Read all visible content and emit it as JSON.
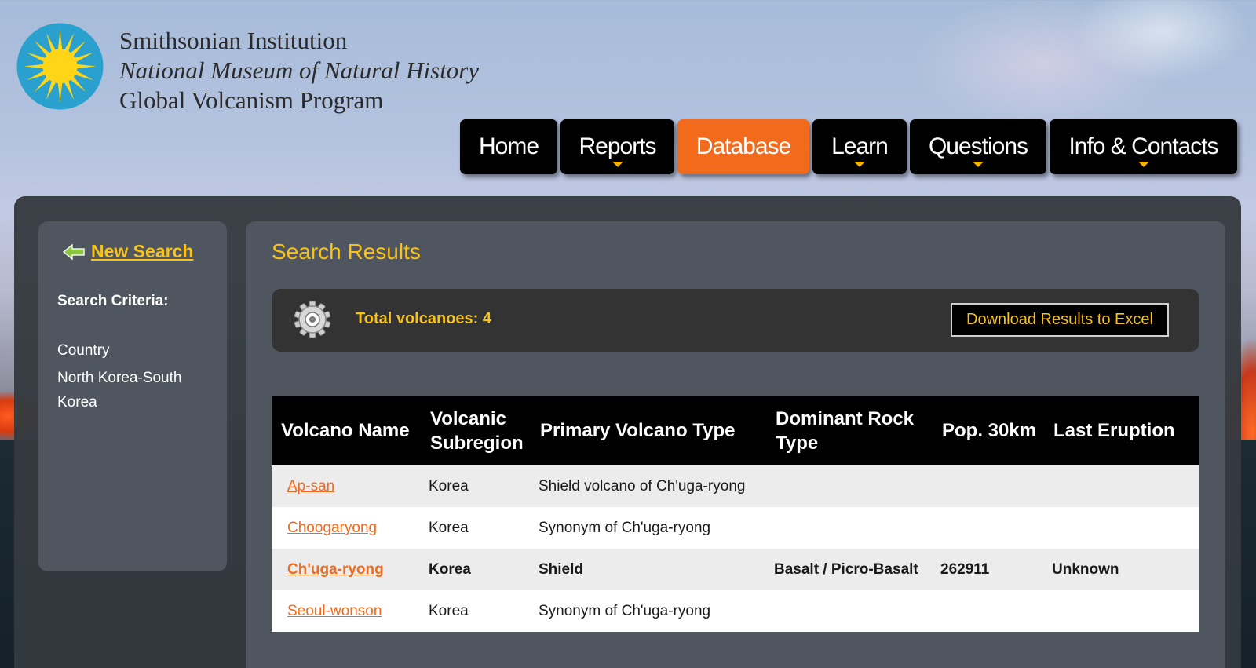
{
  "header": {
    "org": "Smithsonian Institution",
    "museum": "National Museum of Natural History",
    "program": "Global Volcanism Program"
  },
  "nav": [
    {
      "label": "Home",
      "has_menu": false,
      "active": false
    },
    {
      "label": "Reports",
      "has_menu": true,
      "active": false
    },
    {
      "label": "Database",
      "has_menu": false,
      "active": true
    },
    {
      "label": "Learn",
      "has_menu": true,
      "active": false
    },
    {
      "label": "Questions",
      "has_menu": true,
      "active": false
    },
    {
      "label": "Info & Contacts",
      "has_menu": true,
      "active": false
    }
  ],
  "sidebar": {
    "new_search_label": "New Search",
    "criteria_title": "Search Criteria:",
    "criteria_key": "Country",
    "criteria_value": "North Korea-South Korea"
  },
  "results": {
    "title": "Search Results",
    "total_label": "Total volcanoes: 4",
    "download_label": "Download Results to Excel",
    "columns": [
      "Volcano Name",
      "Volcanic Subregion",
      "Primary Volcano Type",
      "Dominant Rock Type",
      "Pop. 30km",
      "Last Eruption"
    ],
    "rows": [
      {
        "name": "Ap-san",
        "subregion": "Korea",
        "type": "Shield volcano of Ch'uga-ryong",
        "rock": "",
        "pop": "",
        "last": ""
      },
      {
        "name": "Choogaryong",
        "subregion": "Korea",
        "type": "Synonym of Ch'uga-ryong",
        "rock": "",
        "pop": "",
        "last": ""
      },
      {
        "name": "Ch'uga-ryong",
        "subregion": "Korea",
        "type": "Shield",
        "rock": "Basalt / Picro-Basalt",
        "pop": "262911",
        "last": "Unknown"
      },
      {
        "name": "Seoul-wonson",
        "subregion": "Korea",
        "type": "Synonym of Ch'uga-ryong",
        "rock": "",
        "pop": "",
        "last": ""
      }
    ]
  },
  "colors": {
    "accent_orange": "#f26a1b",
    "accent_yellow": "#f7c21d",
    "nav_bg": "#000000",
    "panel_bg": "#4f565f"
  },
  "icons": [
    "smithsonian-sun-logo",
    "back-arrow-icon",
    "gear-icon",
    "dropdown-caret-icon"
  ]
}
